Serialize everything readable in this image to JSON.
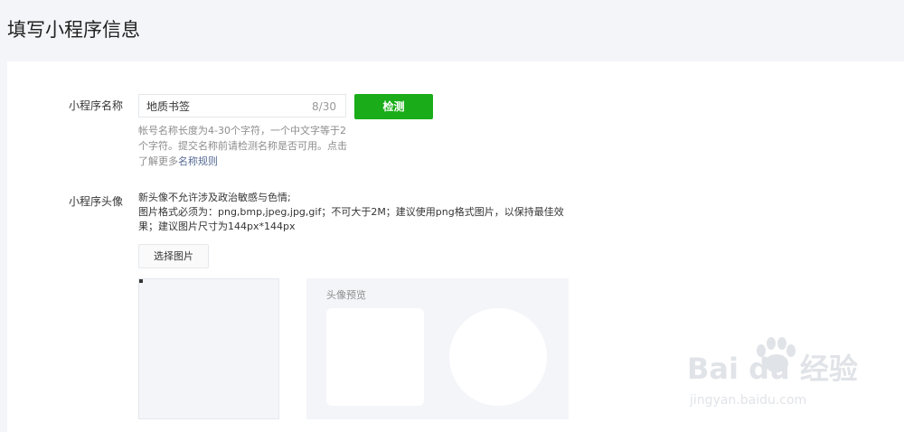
{
  "page": {
    "title": "填写小程序信息"
  },
  "name_section": {
    "label": "小程序名称",
    "input_value": "地质书签",
    "counter": "8/30",
    "check_button": "检测",
    "hint_text": "帐号名称长度为4-30个字符，一个中文字等于2个字符。提交名称前请检测名称是否可用。点击了解更多",
    "hint_link": "名称规则"
  },
  "avatar_section": {
    "label": "小程序头像",
    "rule_lines": [
      "新头像不允许涉及政治敏感与色情;",
      "图片格式必须为：png,bmp,jpeg,jpg,gif；不可大于2M；建议使用png格式图片，以保持最佳效",
      "果；建议图片尺寸为144px*144px"
    ],
    "choose_button": "选择图片",
    "preview_title": "头像预览"
  },
  "watermark": {
    "brand": "Bai du 经验",
    "url": "jingyan.baidu.com"
  },
  "colors": {
    "accent_green": "#1aad19",
    "link_blue": "#576b95",
    "page_background": "#f4f5f9"
  }
}
